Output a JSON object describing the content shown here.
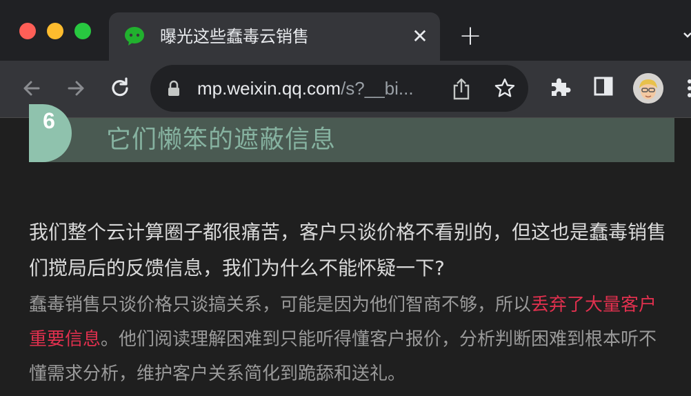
{
  "browser": {
    "tab": {
      "title": "曝光这些蠢毒云销售"
    },
    "address_bar": {
      "host": "mp.weixin.qq.com",
      "path": "/s?__bi..."
    }
  },
  "article": {
    "section": {
      "number": "6",
      "title": "它们懒笨的遮蔽信息"
    },
    "paragraph1": "我们整个云计算圈子都很痛苦，客户只谈价格不看别的，但这也是蠢毒销售们搅局后的反馈信息，我们为什么不能怀疑一下?",
    "paragraph2": {
      "before": "蠢毒销售只谈价格只谈搞关系，可能是因为他们智商不够，所以",
      "highlight": "丢弃了大量客户重要信息",
      "after": "。他们阅读理解困难到只能听得懂客户报价，分析判断困难到根本听不懂需求分析，维护客户关系简化到跪舔和送礼。"
    }
  },
  "colors": {
    "highlight": "#e0304e",
    "section_bg": "#4a5a52",
    "badge_bg": "#8fc2ad"
  }
}
